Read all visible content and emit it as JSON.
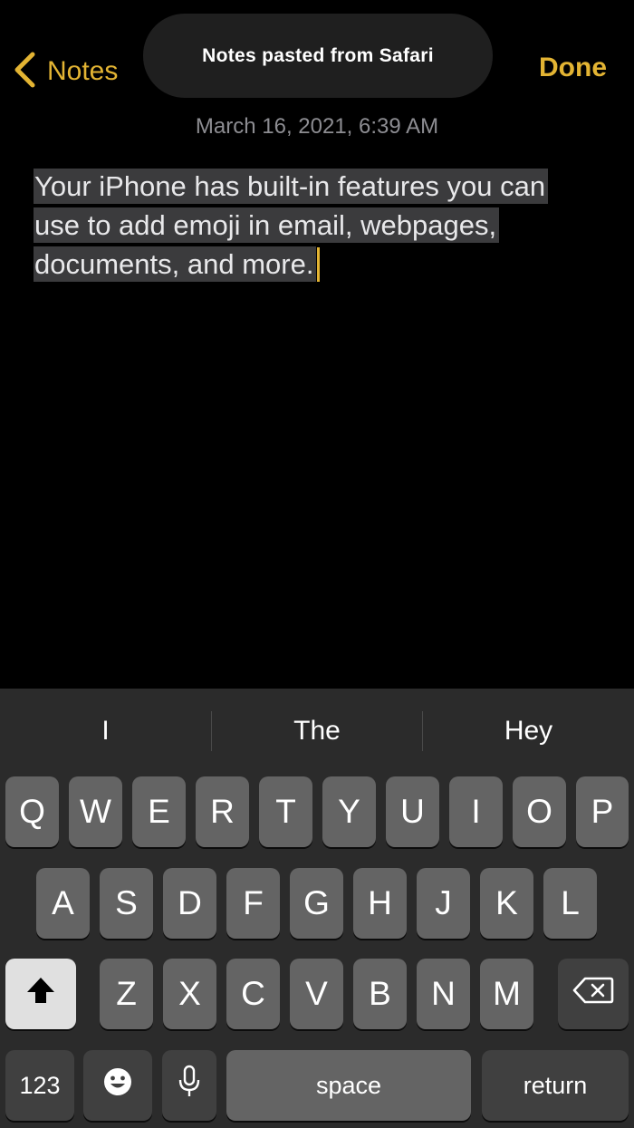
{
  "nav": {
    "back_label": "Notes",
    "done_label": "Done"
  },
  "toast": {
    "text": "Notes pasted from Safari"
  },
  "note": {
    "date": "March 16, 2021, 6:39 AM",
    "lines": [
      "Your iPhone has built-in features you can",
      "use to add emoji in email, webpages,",
      "documents, and more."
    ]
  },
  "keyboard": {
    "suggestions": [
      "I",
      "The",
      "Hey"
    ],
    "row1": [
      "Q",
      "W",
      "E",
      "R",
      "T",
      "Y",
      "U",
      "I",
      "O",
      "P"
    ],
    "row2": [
      "A",
      "S",
      "D",
      "F",
      "G",
      "H",
      "J",
      "K",
      "L"
    ],
    "row3": [
      "Z",
      "X",
      "C",
      "V",
      "B",
      "N",
      "M"
    ],
    "num_label": "123",
    "space_label": "space",
    "return_label": "return",
    "icons": {
      "shift": "shift-icon",
      "delete": "delete-icon",
      "emoji": "emoji-icon",
      "mic": "microphone-icon"
    }
  },
  "colors": {
    "accent": "#e3b433",
    "background": "#000000",
    "keyboard_bg": "#2b2b2b",
    "key": "#646464",
    "func_key": "#404040",
    "selection": "#3b3b3d"
  }
}
